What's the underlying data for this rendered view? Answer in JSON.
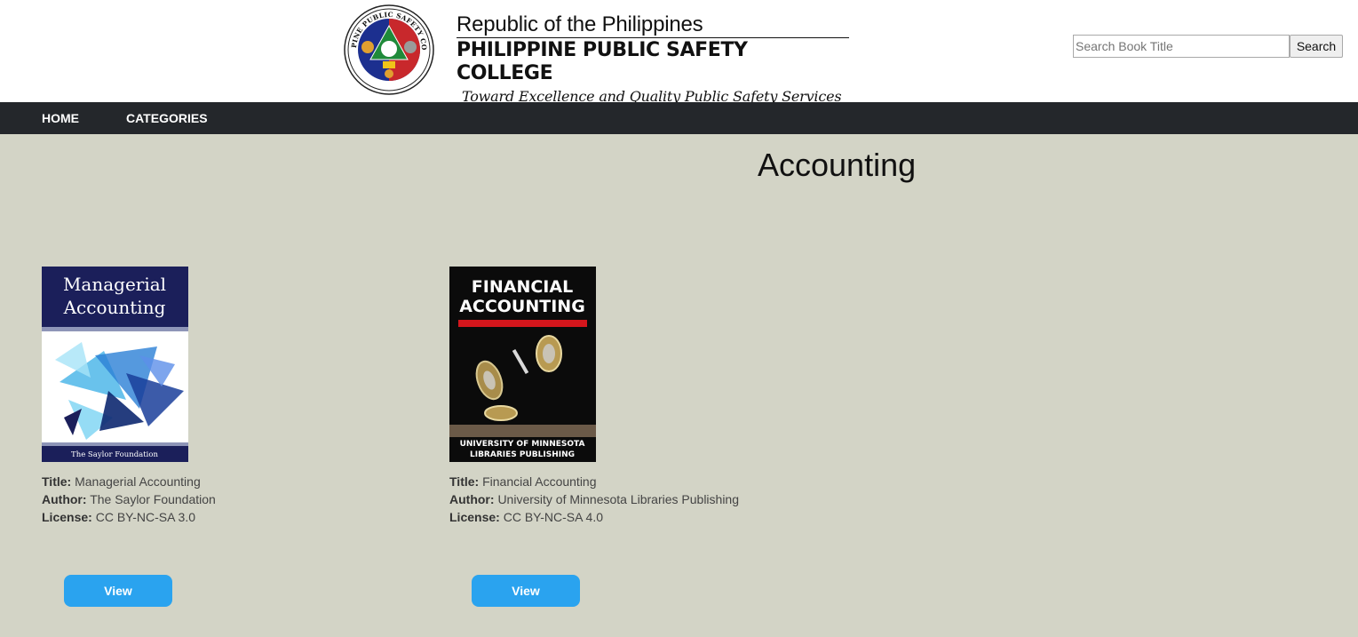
{
  "header": {
    "seal_text": "PHILIPPINE PUBLIC SAFETY COLLEGE",
    "line1": "Republic of the Philippines",
    "line2": "PHILIPPINE PUBLIC SAFETY COLLEGE",
    "tagline": "Toward Excellence and Quality Public Safety Services"
  },
  "search": {
    "placeholder": "Search Book Title",
    "value": "",
    "button_label": "Search"
  },
  "nav": {
    "items": [
      {
        "label": "HOME"
      },
      {
        "label": "CATEGORIES"
      }
    ]
  },
  "page": {
    "title": "Accounting"
  },
  "labels": {
    "title": "Title:",
    "author": "Author:",
    "license": "License:",
    "view": "View"
  },
  "books": [
    {
      "cover_title_line1": "Managerial",
      "cover_title_line2": "Accounting",
      "cover_publisher": "The Saylor Foundation",
      "title": "Managerial Accounting",
      "author": "The Saylor Foundation",
      "license": "CC BY-NC-SA 3.0"
    },
    {
      "cover_title_line1": "FINANCIAL",
      "cover_title_line2": "ACCOUNTING",
      "cover_publisher_line1": "UNIVERSITY OF MINNESOTA",
      "cover_publisher_line2": "LIBRARIES PUBLISHING",
      "title": "Financial Accounting",
      "author": "University of Minnesota Libraries Publishing",
      "license": "CC BY-NC-SA 4.0"
    }
  ],
  "colors": {
    "background": "#d3d4c6",
    "navbar": "#24272b",
    "view_button": "#2aa3ef",
    "cover1_navy": "#1b1f5a",
    "cover2_black": "#0b0b0b",
    "cover2_red": "#d4161c"
  }
}
